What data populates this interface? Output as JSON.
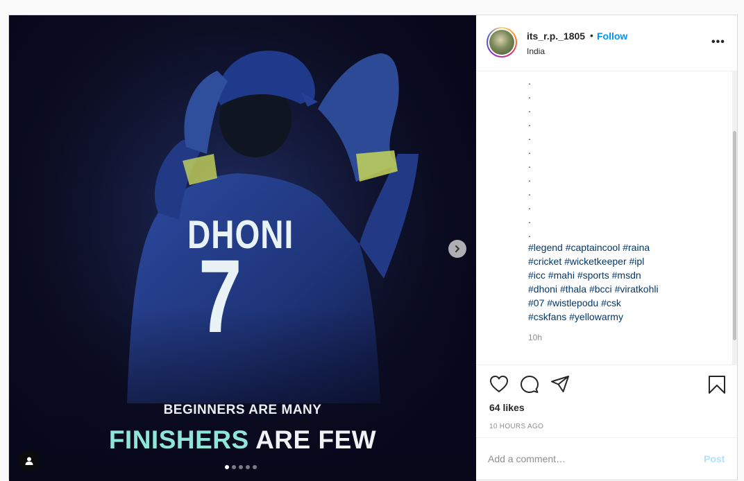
{
  "post": {
    "image": {
      "jersey_name": "DHONI",
      "jersey_number": "7",
      "tagline_top": "BEGINNERS ARE MANY",
      "tagline_bottom_highlight": "FINISHERS",
      "tagline_bottom_rest": " ARE FEW",
      "carousel_count": 5,
      "carousel_active": 1
    },
    "header": {
      "username": "its_r.p._1805",
      "bullet": "•",
      "follow_label": "Follow",
      "location": "India",
      "more_label": "•••"
    },
    "caption": {
      "dots": [
        ".",
        ".",
        ".",
        ".",
        ".",
        ".",
        ".",
        ".",
        ".",
        ".",
        ".",
        "."
      ],
      "hashtags": [
        "#legend",
        "#captaincool",
        "#raina",
        "#cricket",
        "#wicketkeeper",
        "#ipl",
        "#icc",
        "#mahi",
        "#sports",
        "#msdn",
        "#dhoni",
        "#thala",
        "#bcci",
        "#viratkohli",
        "#07",
        "#wistlepodu",
        "#csk",
        "#cskfans",
        "#yellowarmy"
      ],
      "time_ago": "10h"
    },
    "actions": {
      "likes": "64 likes",
      "posted": "10 HOURS AGO"
    },
    "comment": {
      "placeholder": "Add a comment…",
      "post_label": "Post"
    }
  },
  "colors": {
    "link": "#0095f6",
    "hashtag": "#00376b",
    "muted": "#8e8e8e",
    "post_disabled": "#b2dffc"
  }
}
